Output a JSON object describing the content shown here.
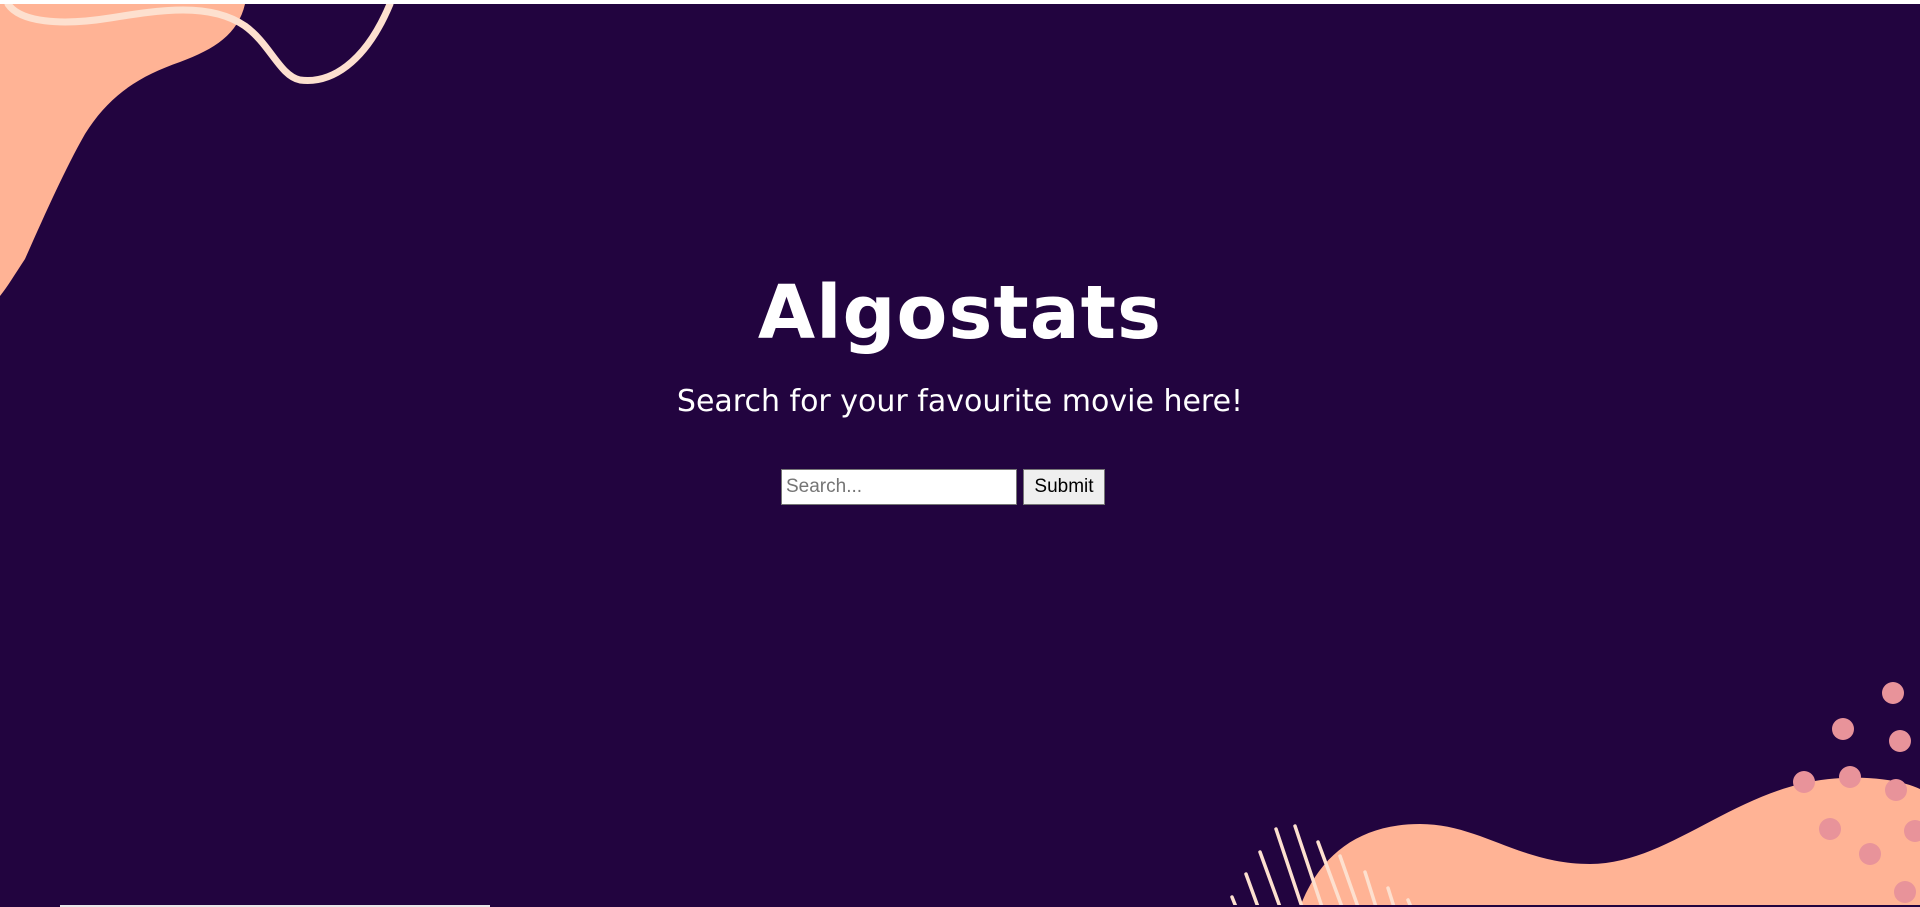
{
  "hero": {
    "title": "Algostats",
    "subtitle": "Search for your favourite movie here!"
  },
  "search": {
    "placeholder": "Search...",
    "value": "",
    "submit_label": "Submit"
  },
  "colors": {
    "background": "#22043f",
    "blob": "#ffb395",
    "line": "#fde0cf",
    "dots": "#e8939a",
    "text": "#ffffff"
  },
  "decorations": [
    "top-left-blob",
    "wavy-line",
    "bottom-right-blob",
    "dots-cluster",
    "diagonal-stripes"
  ]
}
